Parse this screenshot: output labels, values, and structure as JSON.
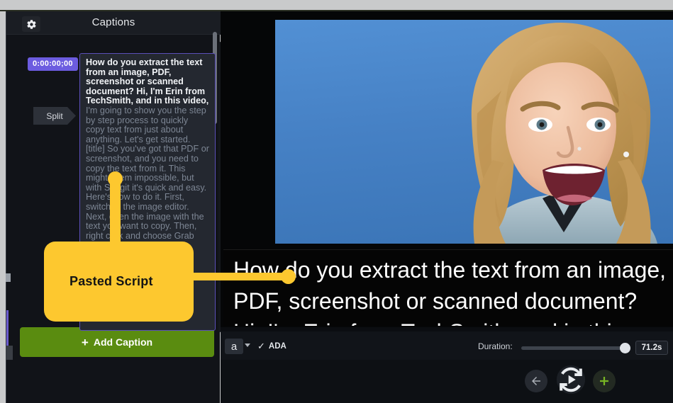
{
  "window": {
    "left_panel_title": "Captions",
    "gear_icon": "gear-icon"
  },
  "captions_panel": {
    "timecode": "0:00:00;00",
    "split_label": "Split",
    "script_bright_1": "How do you extract the text from an image, PDF, screenshot or scanned document?\nHi, I'm Erin from TechSmith, and in this video, ",
    "script_dim_1": "I'm going to show you the step by step process to quickly copy text from just about anything.\nLet's get started.\n[title]\nSo you've got that PDF or screenshot, and you need to copy the text from it. This might seem impossible, but with Snagit it's quick and easy.\nHere's how to do it.\nFirst, switch to the image\neditor.\nNext, open the image\nwith the text you want\nto copy.\nThen, right click and\nchoose Grab Text.",
    "add_caption_label": "Add Caption",
    "add_caption_plus": "+"
  },
  "video": {
    "overlay_caption_line1": "How do you extract the text from an image,",
    "overlay_caption_line2": "PDF, screenshot or scanned document?",
    "overlay_caption_line3": "Hi, I'm Erin from TechSmith, and in this"
  },
  "toolbar": {
    "font_button_label": "a",
    "font_dropdown_icon": "chevron-down-icon",
    "ada_check_icon": "✓",
    "ada_label": "ADA",
    "duration_label": "Duration:",
    "duration_value": "71.2s",
    "duration_percent": 96
  },
  "controls": {
    "back_icon": "arrow-left-icon",
    "replay_icon": "replay-play-icon",
    "add_icon": "plus-icon"
  },
  "annotation": {
    "callout_label": "Pasted Script"
  },
  "colors": {
    "accent_green": "#5a8c10",
    "accent_purple": "#6c5ce0",
    "callout_yellow": "#fdc82f",
    "video_blue": "#4080c6"
  }
}
